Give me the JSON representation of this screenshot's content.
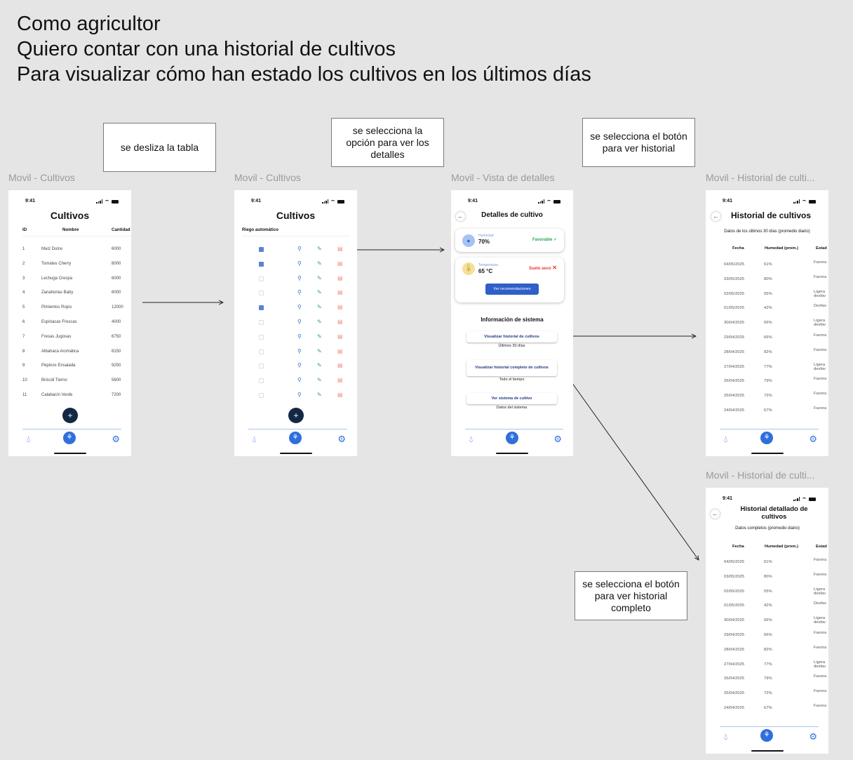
{
  "story": [
    "Como agricultor",
    "Quiero contar con una historial de cultivos",
    "Para visualizar cómo han estado los cultivos en los últimos días"
  ],
  "notes": {
    "n1": "se desliza la tabla",
    "n2": "se selecciona la opción para ver los detalles",
    "n3": "se selecciona el botón para ver historial",
    "n4": "se selecciona el botón para ver historial completo"
  },
  "frame_labels": {
    "f1": "Movil - Cultivos",
    "f2": "Movil - Cultivos",
    "f3": "Movil - Vista de detalles",
    "f4": "Movil - Historial de culti...",
    "f5": "Movil - Historial de culti..."
  },
  "status_time": "9:41",
  "cultivos": {
    "title": "Cultivos",
    "headers": [
      "ID",
      "Nombre",
      "Cantidad"
    ],
    "rows": [
      [
        "1",
        "Maíz Dulce",
        "6000"
      ],
      [
        "2",
        "Tomates Cherry",
        "8000"
      ],
      [
        "3",
        "Lechuga Crespa",
        "6000"
      ],
      [
        "4",
        "Zanahorias Baby",
        "6000"
      ],
      [
        "5",
        "Pimientos Rojos",
        "12000"
      ],
      [
        "6",
        "Espinacas Frescas",
        "4000"
      ],
      [
        "7",
        "Fresas Jugosas",
        "6750"
      ],
      [
        "8",
        "Albahaca Aromática",
        "8150"
      ],
      [
        "9",
        "Pepinos Ensalada",
        "9250"
      ],
      [
        "10",
        "Brócoli Tierno",
        "5600"
      ],
      [
        "11",
        "Calabacín Verde",
        "7200"
      ]
    ],
    "fab": "+"
  },
  "cultivos2": {
    "title": "Cultivos",
    "header": "Riego automático",
    "checked": [
      true,
      true,
      false,
      false,
      true,
      false,
      false,
      false,
      false,
      false,
      false
    ],
    "fab": "+"
  },
  "detalles": {
    "title": "Detalles de cultivo",
    "humedad_label": "Humedad",
    "humedad_value": "70%",
    "humedad_status": "Favorable",
    "temp_label": "Temperatura",
    "temp_value": "65 °C",
    "temp_status": "Suelo seco",
    "recomendaciones": "Ver recomendaciones",
    "info_title": "Información de sistema",
    "btn_hist": "Visualizar historial de cultivos",
    "btn_hist_sub": "Últimos 30 días",
    "btn_full": "Visualizar historial completo de cultivos",
    "btn_full_sub": "Todo el tiempo",
    "btn_sys": "Ver sistema de cultivo",
    "btn_sys_sub": "Datos del sistema"
  },
  "historial": {
    "title": "Historial de cultivos",
    "subtitle": "Datos de los últimos 30 días (promedio diario)",
    "headers": [
      "Fecha",
      "Humedad (prom.)",
      "Estad"
    ],
    "rows": [
      [
        "04/05/2025",
        "61%",
        "Favora"
      ],
      [
        "03/05/2025",
        "80%",
        "Favora"
      ],
      [
        "02/05/2025",
        "55%",
        "Ligera desfav"
      ],
      [
        "01/05/2025",
        "42%",
        "Desfav"
      ],
      [
        "30/04/2025",
        "56%",
        "Ligera desfav"
      ],
      [
        "29/04/2025",
        "66%",
        "Favora"
      ],
      [
        "28/04/2025",
        "82%",
        "Favora"
      ],
      [
        "27/04/2025",
        "77%",
        "Ligera desfav"
      ],
      [
        "26/04/2025",
        "79%",
        "Favora"
      ],
      [
        "25/04/2025",
        "72%",
        "Favora"
      ],
      [
        "24/04/2025",
        "67%",
        "Favora"
      ]
    ]
  },
  "historial_completo": {
    "title": "Historial detallado de cultivos",
    "subtitle": "Datos completos (promedio diario)"
  },
  "colors": {
    "accent": "#2f6fdc",
    "fab": "#132844",
    "favorable": "#2ea44f",
    "warning": "#e53935",
    "button": "#2f5fc7"
  }
}
